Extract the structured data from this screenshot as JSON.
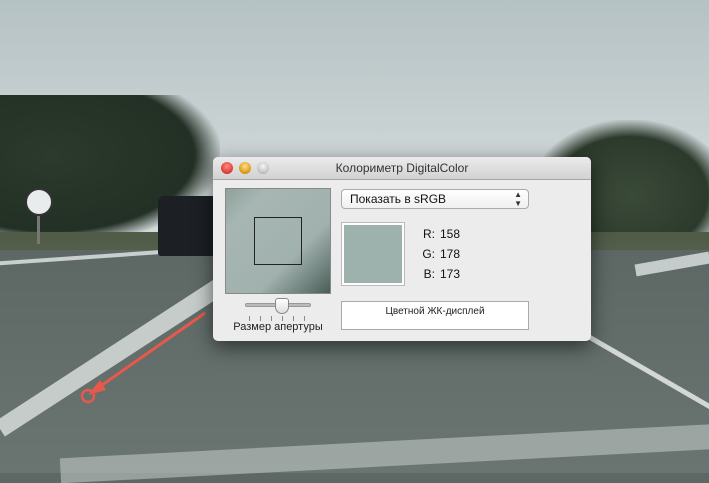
{
  "window": {
    "title": "Колориметр DigitalColor"
  },
  "popup": {
    "selected": "Показать в sRGB"
  },
  "color": {
    "r_label": "R:",
    "r": "158",
    "g_label": "G:",
    "g": "178",
    "b_label": "B:",
    "b": "173",
    "swatch_hex": "#9eb2ad"
  },
  "aperture": {
    "label": "Размер апертуры",
    "slider_fraction": 0.5
  },
  "display": {
    "name": "Цветной ЖК-дисплей"
  },
  "colors": {
    "close": "#e0443e",
    "minimize": "#dea123",
    "zoom": "#c8c8c8",
    "arrow": "#e8584c"
  }
}
